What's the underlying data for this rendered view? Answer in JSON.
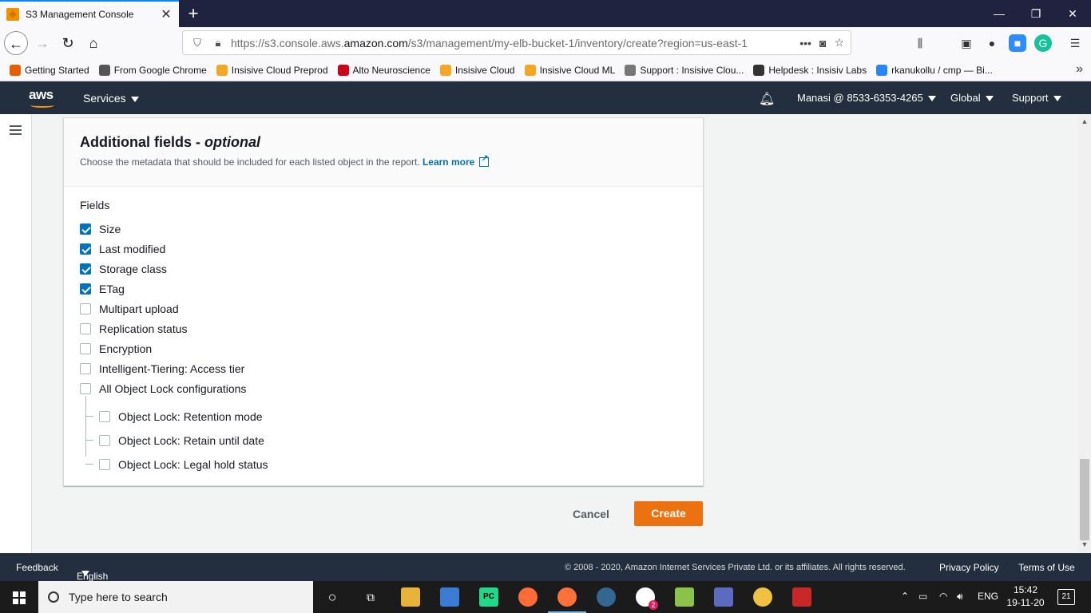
{
  "browser": {
    "tab_title": "S3 Management Console",
    "url_host_prefix": "https://s3.console.aws.",
    "url_host_main": "amazon.com",
    "url_path": "/s3/management/my-elb-bucket-1/inventory/create?region=us-east-1",
    "bookmarks": [
      {
        "label": "Getting Started",
        "icon": "firefox-icon",
        "color": "#e66000"
      },
      {
        "label": "From Google Chrome",
        "icon": "folder-icon",
        "color": "#555555"
      },
      {
        "label": "Insisive Cloud Preprod",
        "icon": "insisive-icon",
        "color": "#f5a623"
      },
      {
        "label": "Alto Neuroscience",
        "icon": "alto-icon",
        "color": "#d0021b"
      },
      {
        "label": "Insisive Cloud",
        "icon": "insisive-icon",
        "color": "#f5a623"
      },
      {
        "label": "Insisive Cloud ML",
        "icon": "insisive-icon",
        "color": "#f5a623"
      },
      {
        "label": "Support : Insisive Clou...",
        "icon": "support-icon",
        "color": "#777777"
      },
      {
        "label": "Helpdesk : Insisiv Labs",
        "icon": "globe-icon",
        "color": "#333333"
      },
      {
        "label": "rkanukollu / cmp — Bi...",
        "icon": "bitbucket-icon",
        "color": "#2684ff"
      }
    ]
  },
  "aws_header": {
    "logo": "aws",
    "services": "Services",
    "account": "Manasi @ 8533-6353-4265",
    "region": "Global",
    "support": "Support"
  },
  "panel": {
    "title": "Additional fields - ",
    "title_italic": "optional",
    "description": "Choose the metadata that should be included for each listed object in the report.",
    "learn_more": "Learn more",
    "fields_label": "Fields",
    "fields": [
      {
        "label": "Size",
        "checked": true
      },
      {
        "label": "Last modified",
        "checked": true
      },
      {
        "label": "Storage class",
        "checked": true
      },
      {
        "label": "ETag",
        "checked": true
      },
      {
        "label": "Multipart upload",
        "checked": false
      },
      {
        "label": "Replication status",
        "checked": false
      },
      {
        "label": "Encryption",
        "checked": false
      },
      {
        "label": "Intelligent-Tiering: Access tier",
        "checked": false
      },
      {
        "label": "All Object Lock configurations",
        "checked": false
      }
    ],
    "sub_fields": [
      {
        "label": "Object Lock: Retention mode",
        "checked": false
      },
      {
        "label": "Object Lock: Retain until date",
        "checked": false
      },
      {
        "label": "Object Lock: Legal hold status",
        "checked": false
      }
    ]
  },
  "actions": {
    "cancel": "Cancel",
    "create": "Create",
    "create_color": "#ec7211"
  },
  "footer": {
    "feedback": "Feedback",
    "language": "English (US)",
    "copyright": "© 2008 - 2020, Amazon Internet Services Private Ltd. or its affiliates. All rights reserved.",
    "privacy": "Privacy Policy",
    "terms": "Terms of Use"
  },
  "taskbar": {
    "search_placeholder": "Type here to search",
    "lang": "ENG",
    "time": "15:42",
    "date": "19-11-20",
    "notifications": "21",
    "slack_badge": "2"
  }
}
